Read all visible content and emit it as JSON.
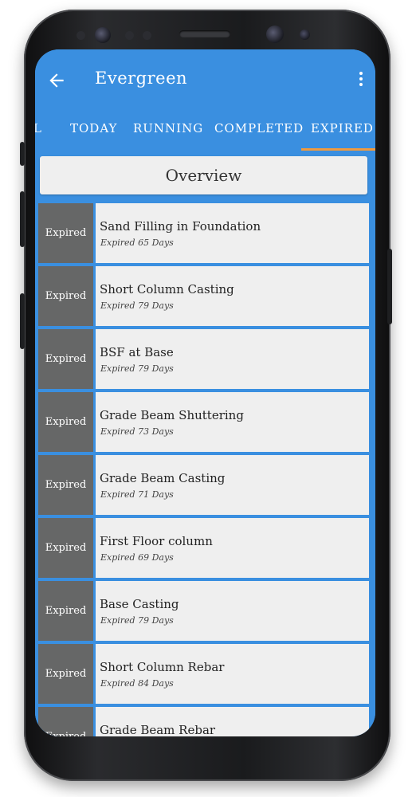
{
  "appbar": {
    "title": "Evergreen",
    "back_icon": "arrow-left-icon",
    "menu_icon": "more-vert-icon"
  },
  "tabs": {
    "partial": "L",
    "items": [
      {
        "label": "TODAY"
      },
      {
        "label": "RUNNING"
      },
      {
        "label": "COMPLETED"
      },
      {
        "label": "EXPIRED",
        "active": true
      }
    ],
    "indicator_color": "#f09a3e"
  },
  "overview": {
    "label": "Overview"
  },
  "colors": {
    "primary": "#3a8fe0",
    "badge": "#666767",
    "card": "#efefef",
    "fab": "#e8405f"
  },
  "tasks": [
    {
      "status": "Expired",
      "title": "Sand Filling in Foundation",
      "subtitle": "Expired 65 Days"
    },
    {
      "status": "Expired",
      "title": "Short Column Casting",
      "subtitle": "Expired 79 Days"
    },
    {
      "status": "Expired",
      "title": "BSF at Base",
      "subtitle": "Expired 79 Days"
    },
    {
      "status": "Expired",
      "title": "Grade Beam Shuttering",
      "subtitle": "Expired 73 Days"
    },
    {
      "status": "Expired",
      "title": "Grade Beam Casting",
      "subtitle": "Expired 71 Days"
    },
    {
      "status": "Expired",
      "title": "First Floor column",
      "subtitle": "Expired 69 Days"
    },
    {
      "status": "Expired",
      "title": "Base Casting",
      "subtitle": "Expired 79 Days"
    },
    {
      "status": "Expired",
      "title": "Short Column Rebar",
      "subtitle": "Expired 84 Days"
    },
    {
      "status": "Expired",
      "title": "Grade Beam Rebar",
      "subtitle": ""
    }
  ],
  "fab": {
    "label": "+",
    "icon": "plus-icon"
  }
}
